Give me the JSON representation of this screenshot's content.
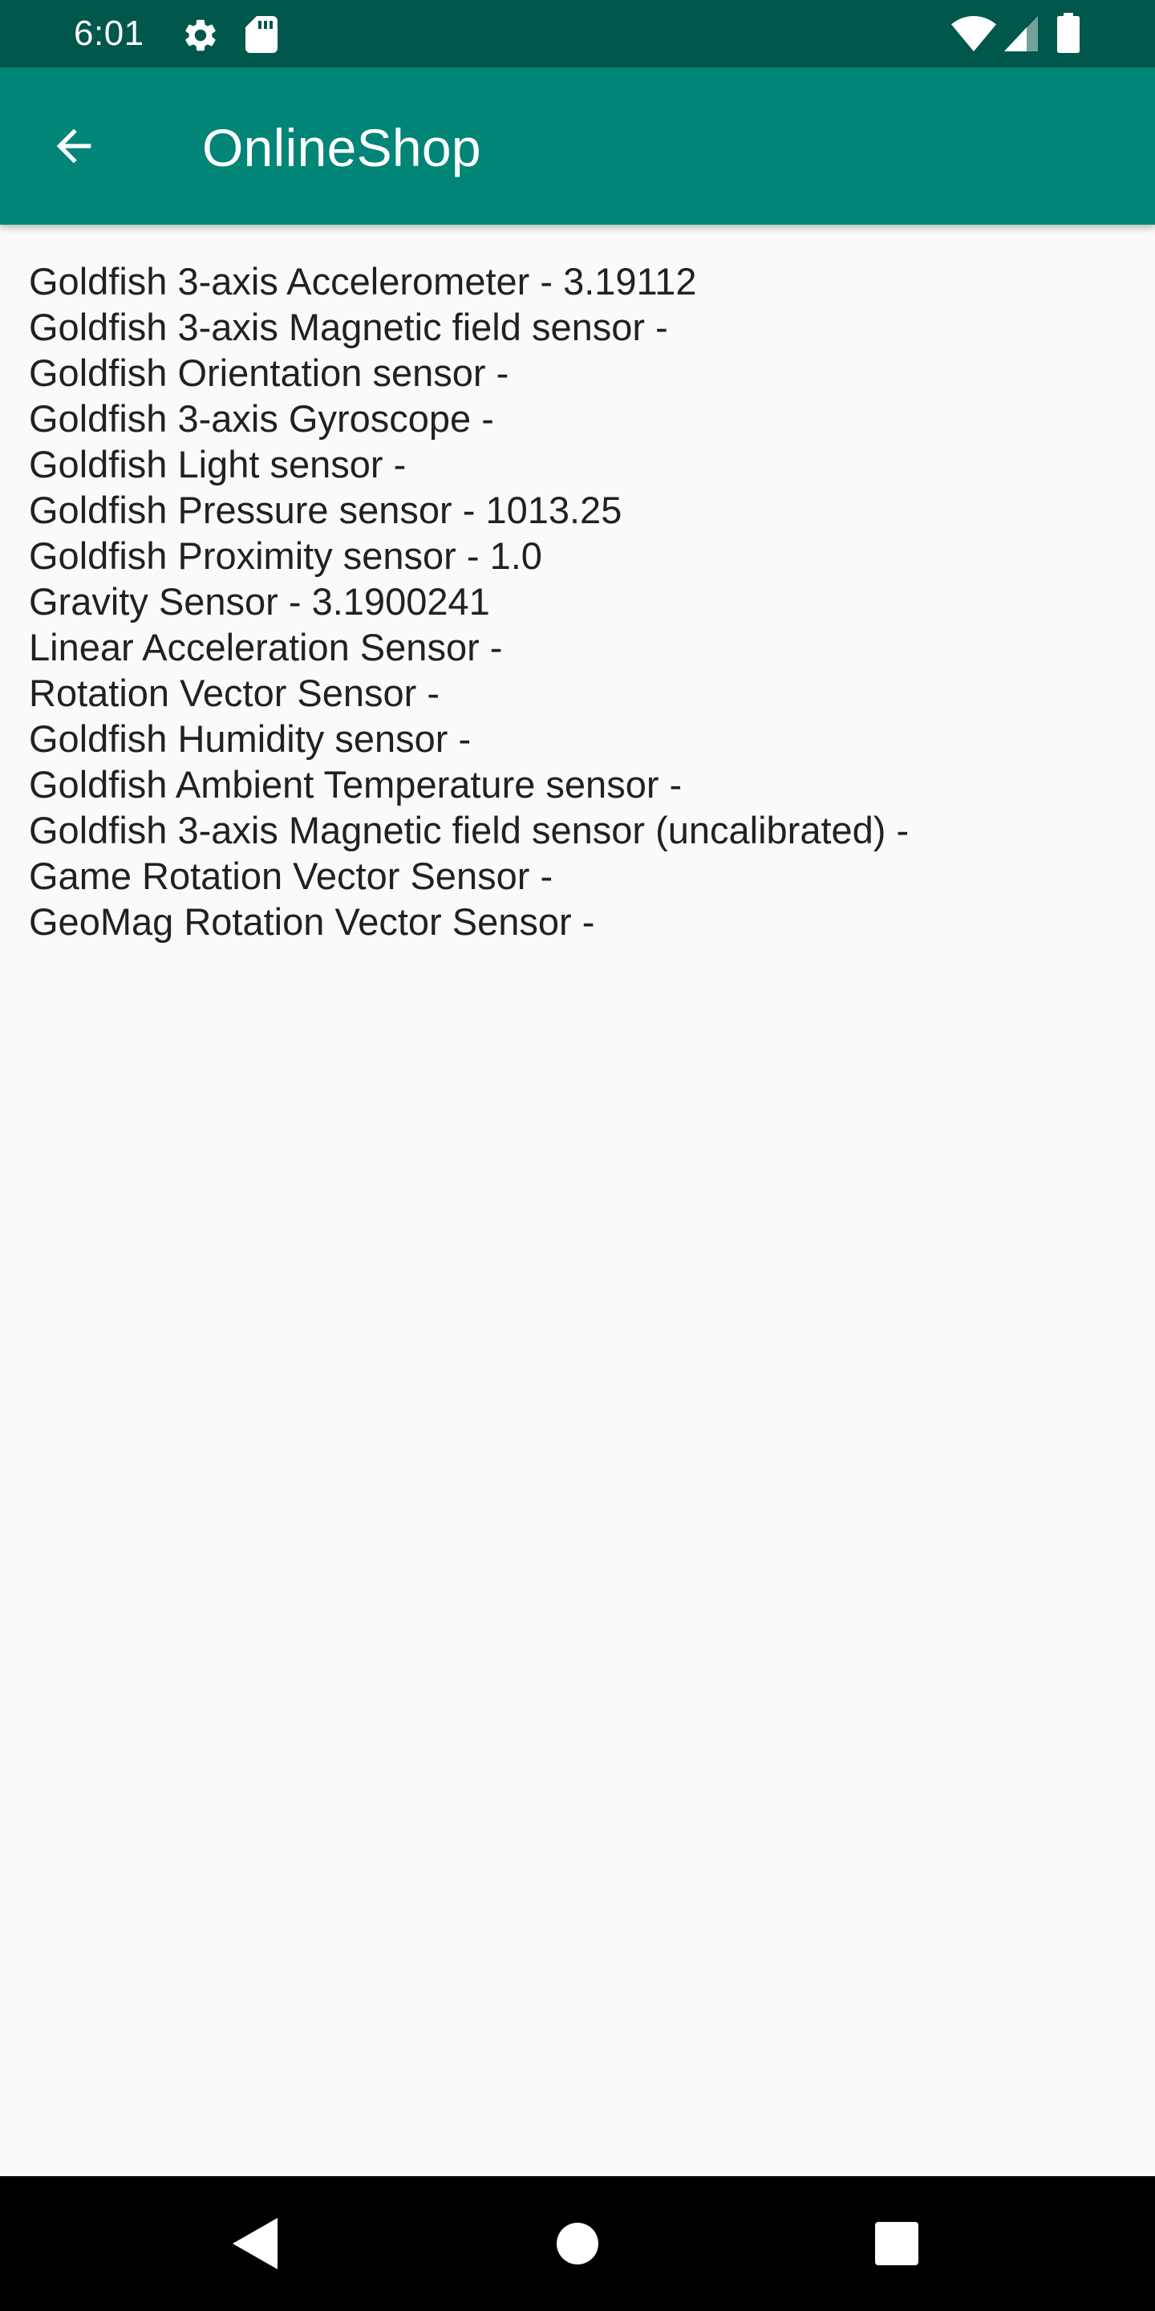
{
  "status_bar": {
    "time": "6:01",
    "icons_left": [
      "gear-icon",
      "sd-card-icon"
    ],
    "icons_right": [
      "wifi-icon",
      "cell-signal-icon",
      "battery-icon"
    ]
  },
  "app_bar": {
    "title": "OnlineShop",
    "back_icon": "arrow-left-icon",
    "color": "#008577",
    "status_color": "#00574b"
  },
  "sensors": [
    "Goldfish 3-axis Accelerometer - 3.19112",
    "Goldfish 3-axis Magnetic field sensor -",
    "Goldfish Orientation sensor -",
    "Goldfish 3-axis Gyroscope -",
    "Goldfish Light sensor -",
    "Goldfish Pressure sensor - 1013.25",
    "Goldfish Proximity sensor - 1.0",
    "Gravity Sensor - 3.1900241",
    "Linear Acceleration Sensor -",
    "Rotation Vector Sensor -",
    "Goldfish Humidity sensor -",
    "Goldfish Ambient Temperature sensor -",
    "Goldfish 3-axis Magnetic field sensor (uncalibrated) -",
    "Game Rotation Vector Sensor -",
    "GeoMag Rotation Vector Sensor -"
  ],
  "nav_bar": {
    "buttons": [
      "back-triangle-icon",
      "home-circle-icon",
      "recents-square-icon"
    ]
  }
}
